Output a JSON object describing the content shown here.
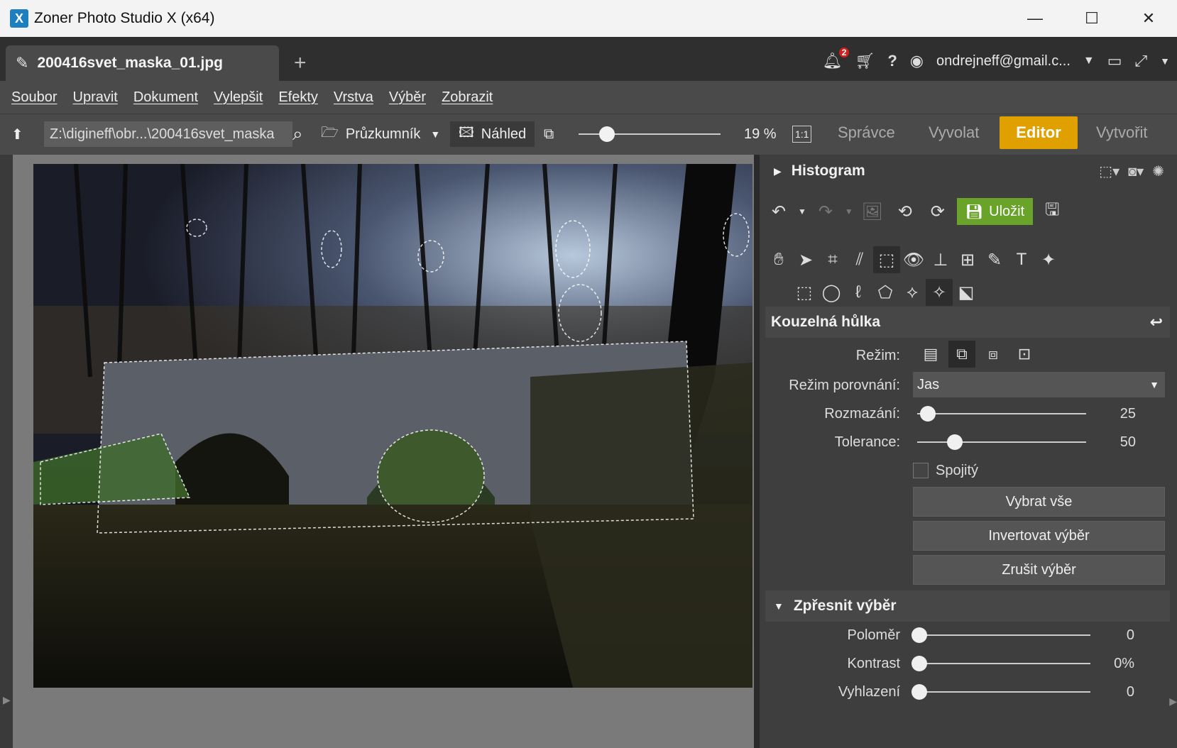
{
  "window": {
    "title": "Zoner Photo Studio X (x64)",
    "logo_letter": "X",
    "minimize": "—",
    "maximize": "☐",
    "close": "✕"
  },
  "tabs": {
    "document_tab": "200416svet_maska_01.jpg",
    "add": "+"
  },
  "topbar": {
    "notifications_count": "2",
    "account_email": "ondrejneff@gmail.c..."
  },
  "menu": [
    "Soubor",
    "Upravit",
    "Dokument",
    "Vylepšit",
    "Efekty",
    "Vrstva",
    "Výběr",
    "Zobrazit"
  ],
  "toolbar": {
    "path": "Z:\\digineff\\obr...\\200416svet_maska",
    "explorer_label": "Průzkumník",
    "preview_label": "Náhled",
    "zoom_value": "19 %",
    "zoom_fraction": 0.15,
    "one_to_one": "1:1",
    "modes": [
      "Správce",
      "Vyvolat",
      "Editor",
      "Vytvořit"
    ],
    "active_mode": "Editor"
  },
  "panel": {
    "histogram_title": "Histogram",
    "save_label": "Uložit",
    "tool_title": "Kouzelná hůlka",
    "mode_label": "Režim:",
    "compare_mode_label": "Režim porovnání:",
    "compare_mode_value": "Jas",
    "blur_label": "Rozmazání:",
    "blur_value": "25",
    "tolerance_label": "Tolerance:",
    "tolerance_value": "50",
    "contiguous_label": "Spojitý",
    "select_all": "Vybrat vše",
    "invert": "Invertovat výběr",
    "cancel": "Zrušit výběr",
    "refine_title": "Zpřesnit výběr",
    "radius_label": "Poloměr",
    "radius_value": "0",
    "contrast_label": "Kontrast",
    "contrast_value": "0%",
    "smooth_label": "Vyhlazení",
    "smooth_value": "0"
  },
  "colors": {
    "accent": "#e0a000",
    "save_green": "#6aa32a"
  }
}
